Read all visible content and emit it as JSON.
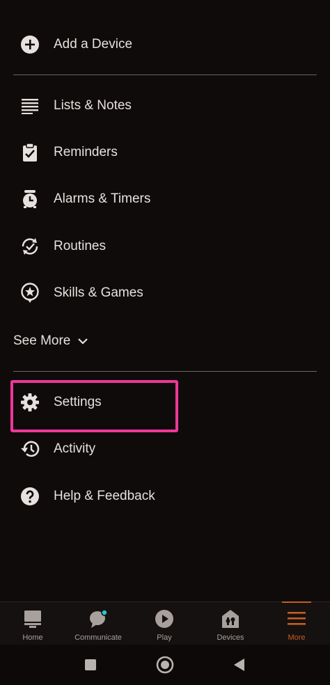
{
  "menu": {
    "add_device": "Add a Device",
    "lists_notes": "Lists & Notes",
    "reminders": "Reminders",
    "alarms_timers": "Alarms & Timers",
    "routines": "Routines",
    "skills_games": "Skills & Games",
    "see_more": "See More",
    "settings": "Settings",
    "activity": "Activity",
    "help_feedback": "Help & Feedback"
  },
  "bottom_nav": {
    "tabs": [
      {
        "label": "Home",
        "icon": "home-icon"
      },
      {
        "label": "Communicate",
        "icon": "communicate-icon"
      },
      {
        "label": "Play",
        "icon": "play-icon"
      },
      {
        "label": "Devices",
        "icon": "devices-icon"
      },
      {
        "label": "More",
        "icon": "more-icon"
      }
    ],
    "active_tab": "More"
  },
  "colors": {
    "background": "#0f0b0a",
    "text": "#e6e1de",
    "highlight": "#f0369a",
    "accent": "#c55d23",
    "notification_dot": "#27c4d1"
  },
  "system_nav": {
    "buttons": [
      "recents-icon",
      "home-circle-icon",
      "back-icon"
    ]
  }
}
